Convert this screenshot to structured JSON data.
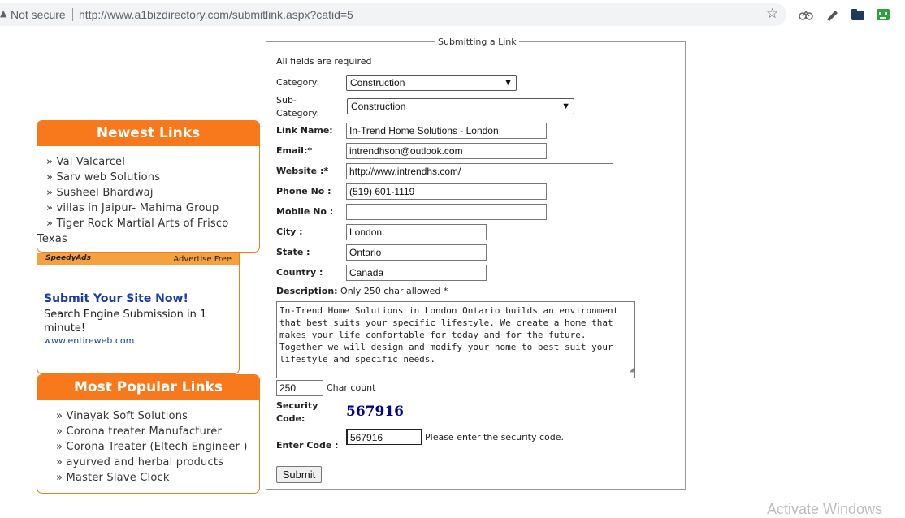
{
  "browser": {
    "security_text": "Not secure",
    "url": "http://www.a1bizdirectory.com/submitlink.aspx?catid=5"
  },
  "newest_links": {
    "title": "Newest Links",
    "items": [
      "» Val Valcarcel",
      "» Sarv web Solutions",
      "» Susheel Bhardwaj",
      "» villas in Jaipur- Mahima Group",
      "» Tiger Rock Martial Arts of Frisco",
      "Texas"
    ]
  },
  "ad": {
    "brand": "SpeedyAds",
    "advertise_label": "Advertise Free",
    "title": "Submit Your Site Now!",
    "text": "Search Engine Submission in 1 minute!",
    "link": "www.entireweb.com"
  },
  "popular_links": {
    "title": "Most Popular Links",
    "items": [
      "» Vinayak Soft Solutions",
      "» Corona treater Manufacturer",
      "» Corona Treater (Eltech Engineer )",
      "» ayurved and herbal products",
      "» Master Slave Clock"
    ]
  },
  "form": {
    "legend": "Submitting a Link",
    "required_note": "All fields are required",
    "category_label": "Category:",
    "category_value": "Construction",
    "subcategory_label_1": "Sub-",
    "subcategory_label_2": "Category:",
    "subcategory_value": "Construction",
    "link_name_label": "Link Name:",
    "link_name_value": "In-Trend Home Solutions - London",
    "email_label": "Email:*",
    "email_value": "intrendhson@outlook.com",
    "website_label": "Website :*",
    "website_value": "http://www.intrendhs.com/",
    "phone_label": "Phone No :",
    "phone_value": "(519) 601-1119",
    "mobile_label": "Mobile No :",
    "mobile_value": "",
    "city_label": "City :",
    "city_value": "London",
    "state_label": "State :",
    "state_value": "Ontario",
    "country_label": "Country :",
    "country_value": "Canada",
    "description_label": "Description:",
    "description_hint": "Only 250 char allowed *",
    "description_value": "In-Trend Home Solutions in London Ontario builds an environment that best suits your specific lifestyle. We create a home that makes your life comfortable for today and for the future. Together we will design and modify your home to best suit your lifestyle and specific needs.",
    "char_count_value": "250",
    "char_count_label": "Char count",
    "security_label_1": "Security",
    "security_label_2": "Code:",
    "security_code": "567916",
    "enter_code_label": "Enter Code :",
    "enter_code_value": "567916",
    "enter_code_hint": "Please enter the security code.",
    "submit_label": "Submit"
  },
  "watermark": "Activate Windows",
  "colors": {
    "accent": "#f7791b",
    "link_blue": "#1a3aa8",
    "code_blue": "#00008b"
  }
}
